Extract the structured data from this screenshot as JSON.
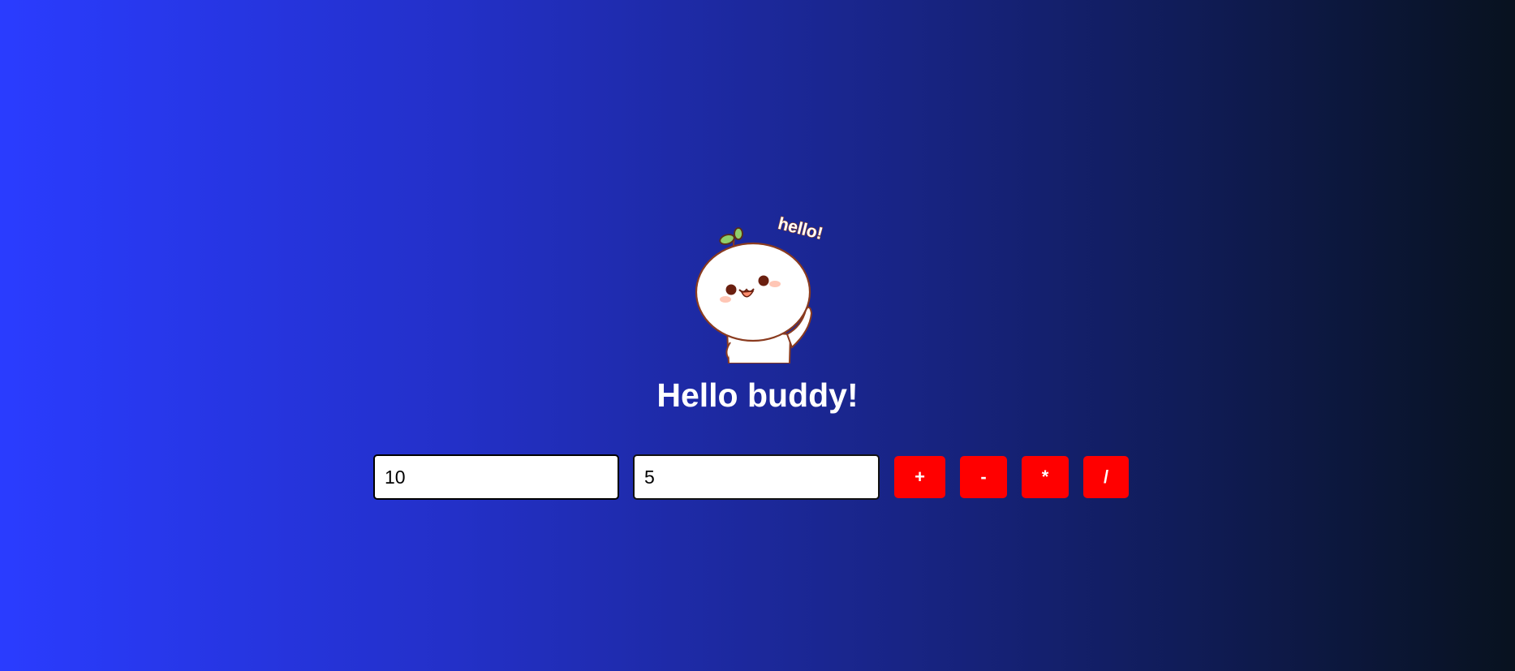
{
  "mascot": {
    "icon": "waving-mascot-icon",
    "caption": "hello!"
  },
  "heading": "Hello buddy!",
  "calculator": {
    "input_a": "10",
    "input_b": "5",
    "buttons": {
      "add": "+",
      "subtract": "-",
      "multiply": "*",
      "divide": "/"
    }
  },
  "colors": {
    "background_start": "#2a3cff",
    "background_end": "#08121f",
    "button": "#ff0000",
    "heading": "#ffffff"
  }
}
